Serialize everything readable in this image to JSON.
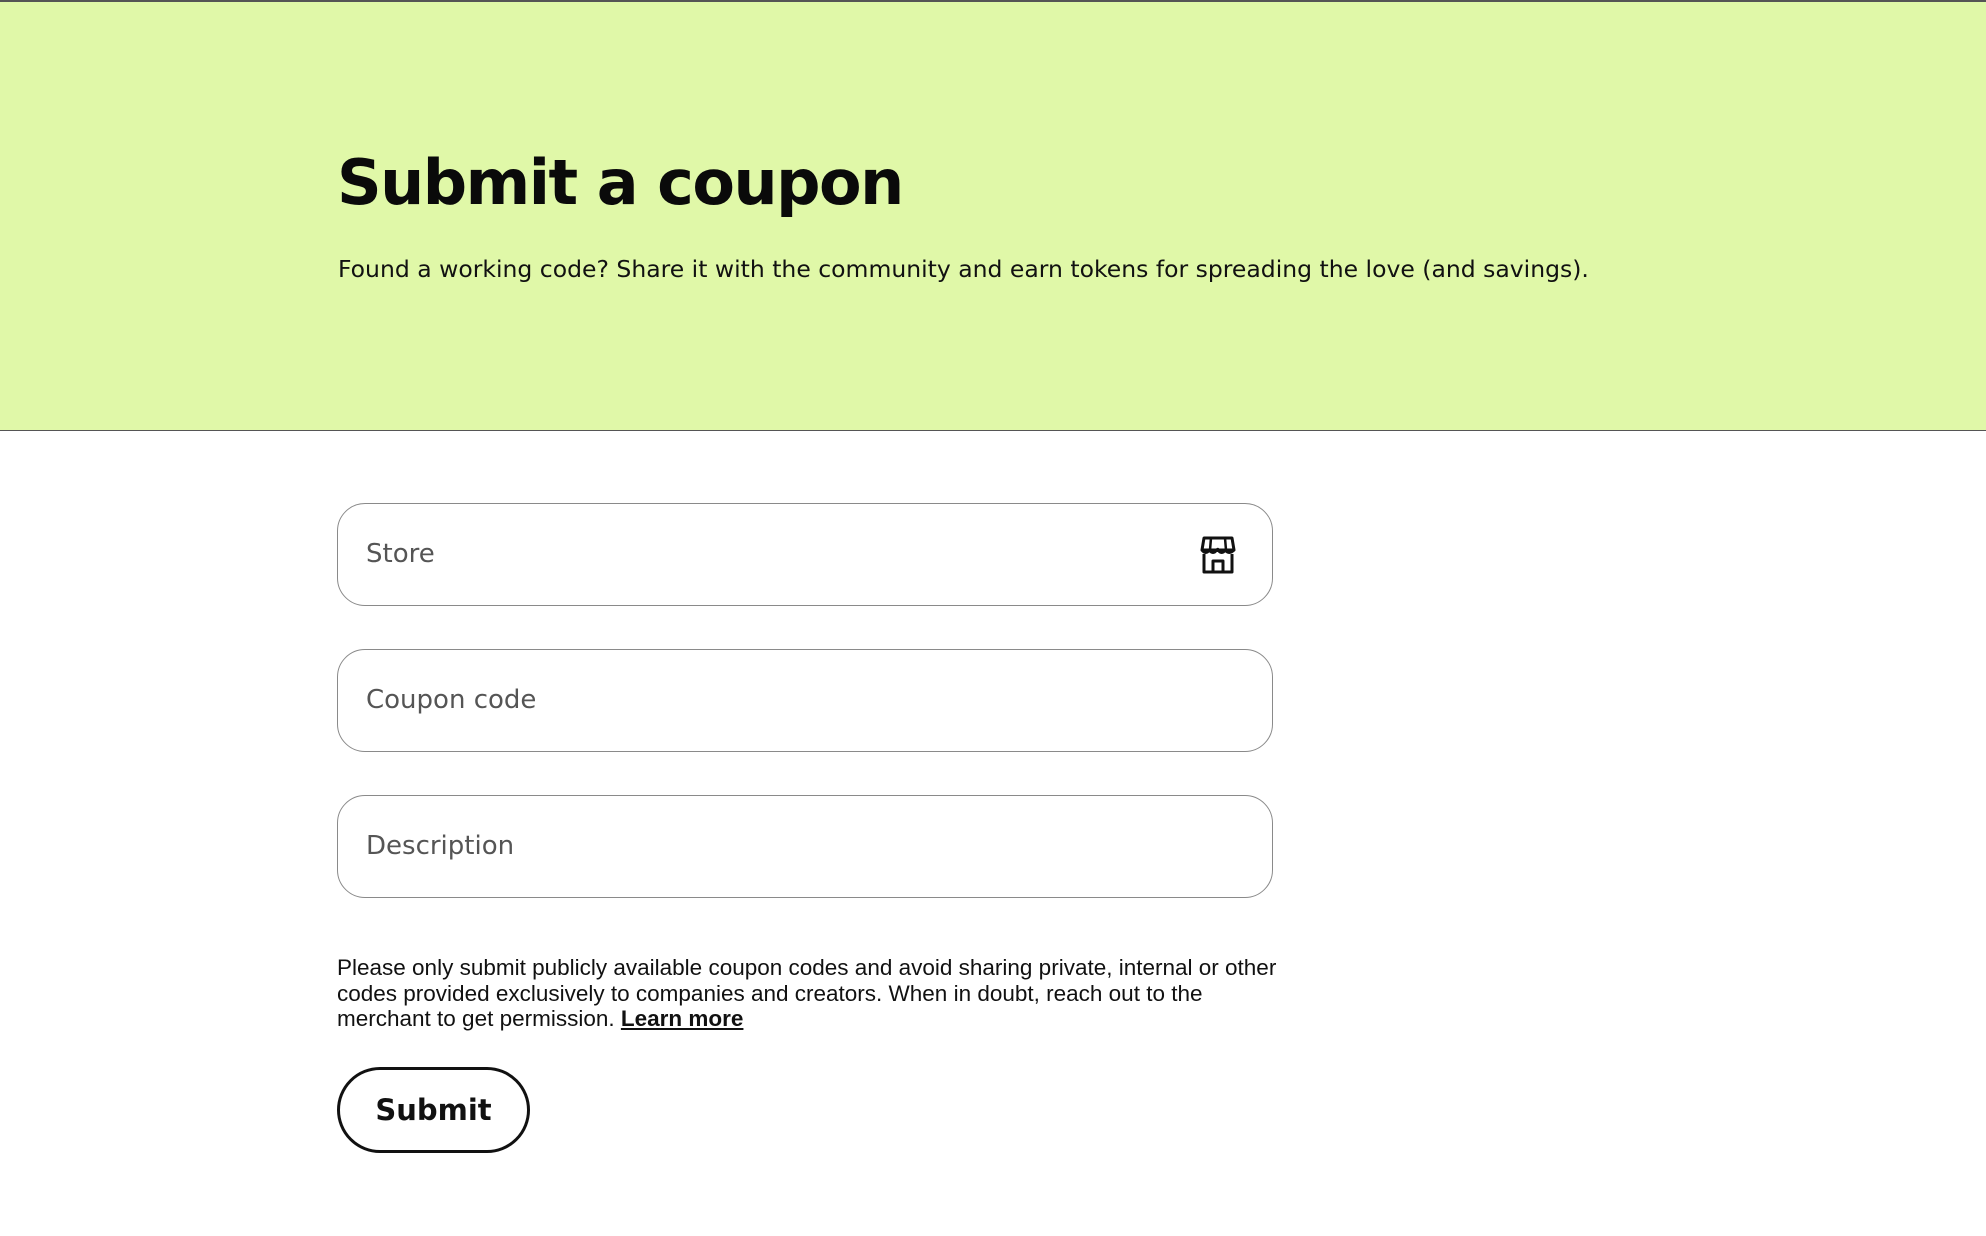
{
  "hero": {
    "title": "Submit a coupon",
    "subtitle": "Found a working code? Share it with the community and earn tokens for spreading the love (and savings).",
    "background_color": "#e0f8a8"
  },
  "form": {
    "store": {
      "placeholder": "Store",
      "value": "",
      "icon": "store-icon"
    },
    "coupon_code": {
      "placeholder": "Coupon code",
      "value": ""
    },
    "description": {
      "placeholder": "Description",
      "value": ""
    },
    "notice": "Please only submit publicly available coupon codes and avoid sharing private, internal or other codes provided exclusively to companies and creators. When in doubt, reach out to the merchant to get permission.",
    "learn_more_label": "Learn more",
    "submit_label": "Submit"
  }
}
